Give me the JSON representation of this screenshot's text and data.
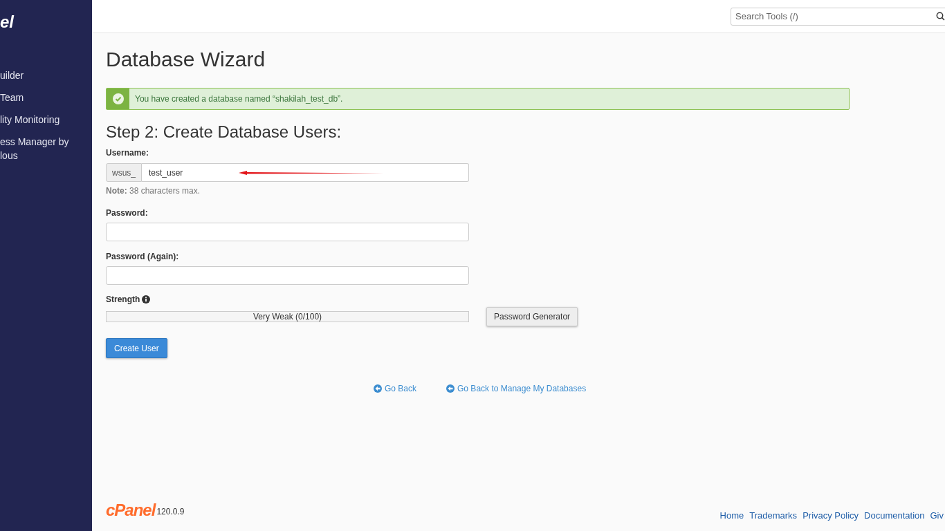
{
  "sidebar": {
    "logo_text": "el",
    "items": [
      {
        "label": "uilder"
      },
      {
        "label": "Team"
      },
      {
        "label": "lity Monitoring"
      },
      {
        "label": "ess Manager by lous"
      }
    ]
  },
  "search": {
    "placeholder": "Search Tools (/)"
  },
  "page_title": "Database Wizard",
  "alert": {
    "kind": "success",
    "message": "You have created a database named “shakilah_test_db”."
  },
  "step_heading": "Step 2: Create Database Users:",
  "username": {
    "label": "Username:",
    "prefix": "wsus_",
    "value": "test_user",
    "note_label": "Note:",
    "note": "38 characters max."
  },
  "password": {
    "label": "Password:"
  },
  "password_again": {
    "label": "Password (Again):"
  },
  "strength": {
    "label": "Strength",
    "level": 0,
    "reading": "Very Weak (0/100)"
  },
  "password_generator_button": "Password Generator",
  "create_button": "Create User",
  "back_links": [
    "Go Back",
    "Go Back to Manage My Databases"
  ],
  "footer": {
    "logo_text": "cPanel",
    "version": "120.0.9",
    "links": [
      "Home",
      "Trademarks",
      "Privacy Policy",
      "Documentation",
      "Giv"
    ]
  }
}
